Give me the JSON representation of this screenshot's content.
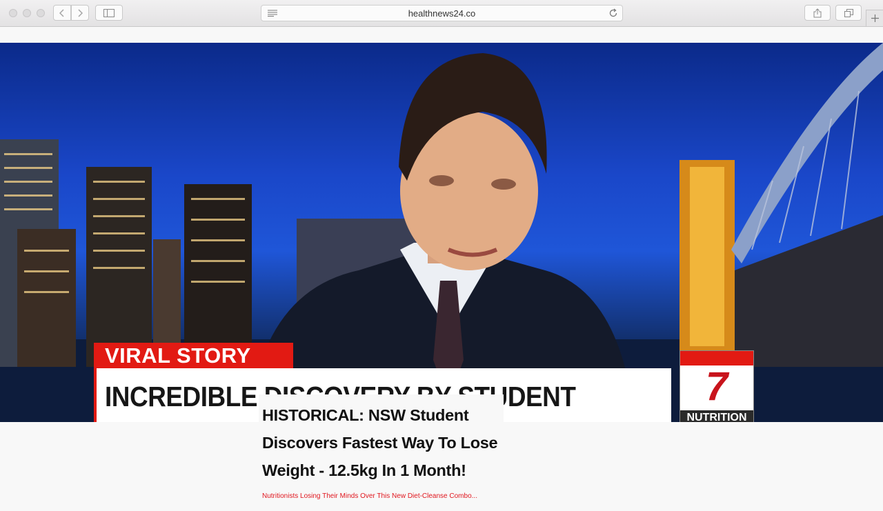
{
  "browser": {
    "url": "healthnews24.co",
    "icons": [
      "back-icon",
      "forward-icon",
      "sidebar-icon",
      "reader-icon",
      "reload-icon",
      "share-icon",
      "tabs-icon",
      "new-tab-icon"
    ]
  },
  "broadcast": {
    "tag": "VIRAL STORY",
    "headline": "INCREDIBLE DISCOVERY BY STUDENT",
    "channel_number": "7",
    "channel_label": "NUTRITION",
    "colors": {
      "tag_red": "#e21a13",
      "bar_white": "#ffffff",
      "sky_blue": "#1f56d8"
    }
  },
  "article": {
    "headline": "HISTORICAL: NSW Student Discovers Fastest Way To Lose Weight - 12.5kg In 1 Month!",
    "subheadline": "Nutritionists Losing Their Minds Over This New Diet-Cleanse Combo...",
    "colors": {
      "headline": "#111111",
      "subheadline": "#e0161e"
    }
  }
}
